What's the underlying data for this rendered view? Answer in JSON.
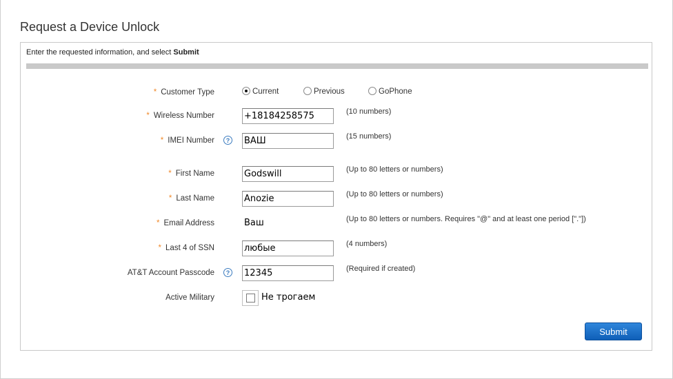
{
  "page": {
    "title": "Request a Device Unlock"
  },
  "form": {
    "instructions_prefix": "Enter the requested information, and select ",
    "instructions_bold": "Submit",
    "customer_type": {
      "label": "Customer Type",
      "options": [
        "Current",
        "Previous",
        "GoPhone"
      ],
      "selected": "Current"
    },
    "wireless_number": {
      "label": "Wireless Number",
      "value": "+18184258575",
      "hint": "(10 numbers)"
    },
    "imei_number": {
      "label": "IMEI Number",
      "value": "ВАШ",
      "hint": "(15 numbers)"
    },
    "first_name": {
      "label": "First Name",
      "value": "Godswill",
      "hint": "(Up to 80 letters or numbers)"
    },
    "last_name": {
      "label": "Last Name",
      "value": "Anozie",
      "hint": "(Up to 80 letters or numbers)"
    },
    "email_address": {
      "label": "Email Address",
      "value": "Ваш",
      "hint": "(Up to 80 letters or numbers. Requires \"@\" and at least one period [\".\"])"
    },
    "last4_ssn": {
      "label": "Last 4 of SSN",
      "value": "любые",
      "hint": "(4 numbers)"
    },
    "account_passcode": {
      "label": "AT&T Account Passcode",
      "value": "12345",
      "hint": "(Required if created)"
    },
    "active_military": {
      "label": "Active Military",
      "checked": false,
      "annotation": "Не трогаем"
    },
    "required_marker": "*",
    "help_glyph": "?",
    "submit_label": "Submit"
  },
  "colors": {
    "required": "#f08a2c",
    "help": "#3b7bbf",
    "button": "#0f5fb8"
  },
  "icons": {
    "help": "help-question-icon"
  }
}
